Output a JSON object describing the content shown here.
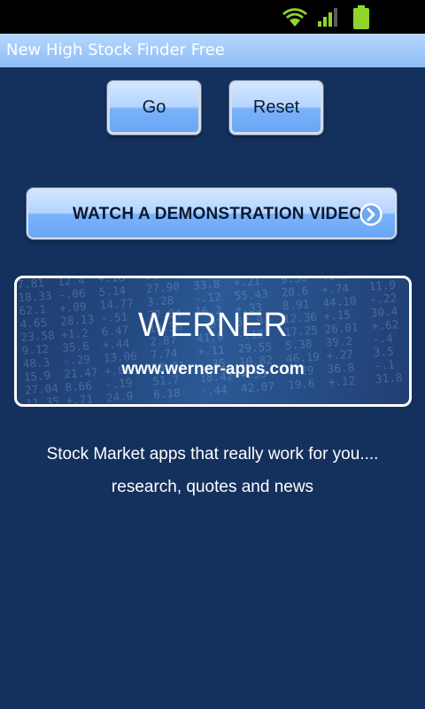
{
  "status_bar": {
    "icons": [
      "wifi-icon",
      "signal-icon",
      "battery-icon"
    ],
    "colors": {
      "green": "#8ed42a",
      "bg": "#000000"
    }
  },
  "app": {
    "title": "New High Stock Finder Free"
  },
  "buttons": {
    "go_label": "Go",
    "reset_label": "Reset",
    "demo_label": "WATCH A DEMONSTRATION VIDEO",
    "demo_icon": "arrow-right-circle-icon"
  },
  "banner": {
    "title": "WERNER",
    "url": "www.werner-apps.com"
  },
  "tagline": {
    "line1": "Stock Market apps that really work for you....",
    "line2": "research, quotes and news"
  },
  "colors": {
    "background": "#14305c",
    "title_bar": "#8dbcf5",
    "button": "#7ab2fb"
  }
}
